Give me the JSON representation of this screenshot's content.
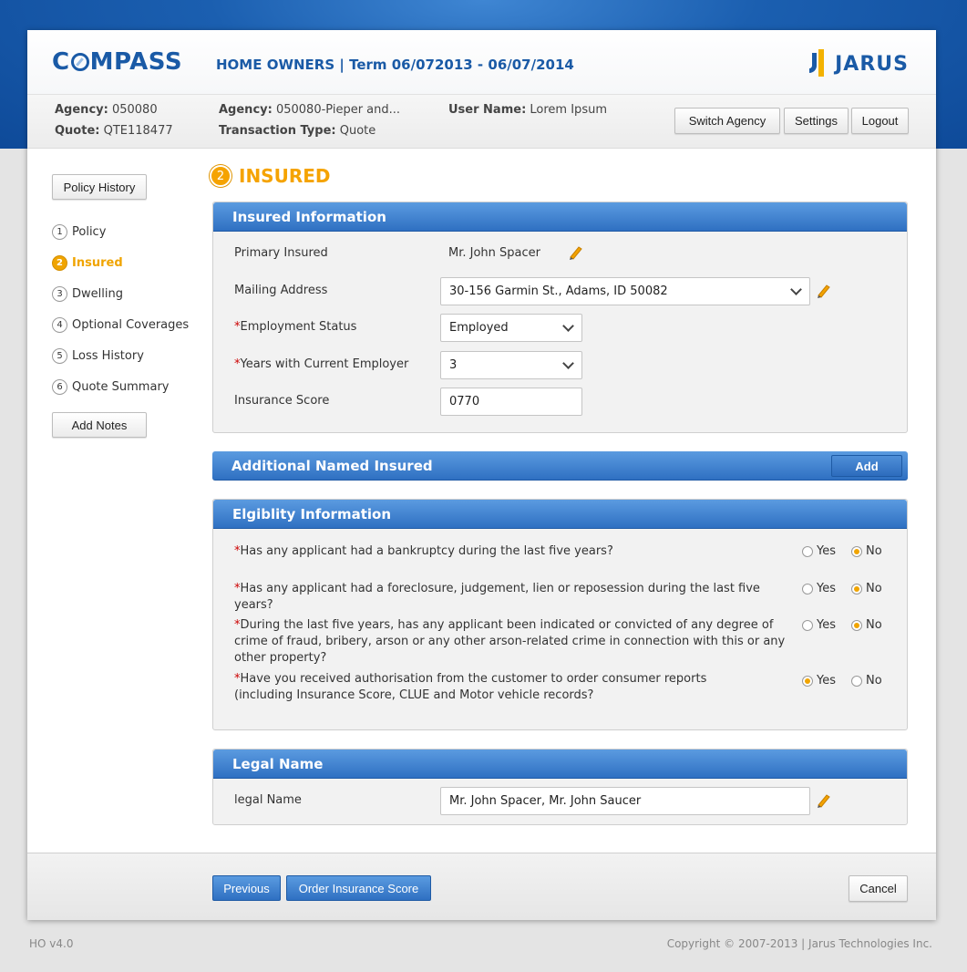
{
  "header": {
    "logo": "COMPASS",
    "logo_pre": "C",
    "logo_post": "MPASS",
    "term": "HOME OWNERS | Term 06/072013 - 06/07/2014",
    "brand": "JARUS"
  },
  "infobar": {
    "agency_label": "Agency:",
    "agency_value": "050080",
    "quote_label": "Quote:",
    "quote_value": "QTE118477",
    "agency2_label": "Agency:",
    "agency2_value": "050080-Pieper and...",
    "transaction_label": "Transaction Type:",
    "transaction_value": "Quote",
    "user_label": "User Name:",
    "user_value": "Lorem Ipsum",
    "buttons": [
      "Switch Agency",
      "Settings",
      "Logout"
    ]
  },
  "sidebar": {
    "policy_history": "Policy History",
    "items": [
      {
        "num": "1",
        "label": "Policy"
      },
      {
        "num": "2",
        "label": "Insured"
      },
      {
        "num": "3",
        "label": "Dwelling"
      },
      {
        "num": "4",
        "label": "Optional Coverages"
      },
      {
        "num": "5",
        "label": "Loss History"
      },
      {
        "num": "6",
        "label": "Quote Summary"
      }
    ],
    "add_notes": "Add Notes"
  },
  "page": {
    "step": "2",
    "title": "INSURED"
  },
  "insured_info": {
    "title": "Insured Information",
    "primary_label": "Primary Insured",
    "primary_value": "Mr. John Spacer",
    "mailing_label": "Mailing Address",
    "mailing_value": "30-156 Garmin St., Adams, ID 50082",
    "employment_label": "Employment Status",
    "employment_value": "Employed",
    "years_label": "Years with Current Employer",
    "years_value": "3",
    "score_label": "Insurance Score",
    "score_value": "0770",
    "required_mark": "*"
  },
  "additional": {
    "title": "Additional Named Insured",
    "add": "Add"
  },
  "eligibility": {
    "title": "Elgiblity Information",
    "yes": "Yes",
    "no": "No",
    "questions": [
      {
        "text": "Has any applicant had a bankruptcy during the last five years?",
        "answer": "No"
      },
      {
        "text": "Has any applicant had a foreclosure, judgement, lien or reposession during the last five years?",
        "answer": "No"
      },
      {
        "text": "During the last five years, has any applicant been indicated or convicted of any degree of crime of fraud, bribery, arson or any other arson-related crime in connection with this or any other property?",
        "answer": "No"
      },
      {
        "text": "Have you received authorisation from the customer to order consumer reports (including Insurance Score, CLUE and Motor vehicle records?",
        "answer": "Yes"
      }
    ]
  },
  "legal": {
    "title": "Legal Name",
    "label": "legal Name",
    "value": "Mr. John Spacer, Mr. John Saucer"
  },
  "footer": {
    "previous": "Previous",
    "order": "Order Insurance Score",
    "cancel": "Cancel"
  },
  "bottom": {
    "version": "HO v4.0",
    "copyright": "Copyright © 2007-2013 | Jarus Technologies Inc."
  },
  "colors": {
    "accent": "#f5a300",
    "brand": "#1a5aa6",
    "panel_header": "#2f70c2"
  }
}
